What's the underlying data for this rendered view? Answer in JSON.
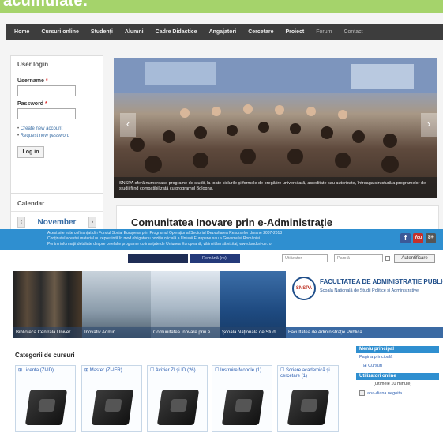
{
  "caption": {
    "text": "acumulate:"
  },
  "site1": {
    "nav": [
      "Home",
      "Cursuri online",
      "Studenți",
      "Alumni",
      "Cadre Didactice",
      "Angajatori",
      "Cercetare",
      "Proiect",
      "Forum",
      "Contact"
    ],
    "login": {
      "title": "User login",
      "username_label": "Username",
      "password_label": "Password",
      "required_mark": "*",
      "links": [
        "Create new account",
        "Request new password"
      ],
      "button": "Log in"
    },
    "calendar": {
      "title": "Calendar",
      "month": "November",
      "prev": "‹",
      "next": "›"
    },
    "slideshow": {
      "caption": "SNSPA oferă numeroase programe de studii, la toate ciclurile și formele de pregătire universitară, acreditate sau autorizate, întreaga structură a programelor de studii fiind compatibilizată cu programul Bologna.",
      "prev": "‹",
      "next": "›"
    },
    "featured_title": "Comunitatea Inovare prin e-Administrație"
  },
  "site2": {
    "notice": [
      "Acest site este cofinanțat din Fondul Social European prin Programul Operațional Sectorial Dezvoltarea Resurselor Umane 2007-2013",
      "Conținutul acestui material nu reprezintă în mod obligatoriu poziția oficială a Uniunii Europene sau a Guvernului României",
      "Pentru informații detaliate despre celelalte programe cofinanțate de Uniunea Europeană, vă invităm să vizitați www.fonduri-ue.ro"
    ],
    "social": [
      "f",
      "You",
      "8+"
    ],
    "language": "Română (ro)",
    "user_placeholder": "Utilizator",
    "pass_placeholder": "Parolă",
    "auth_button": "Autentificare",
    "banner_labels": [
      "Biblioteca Centrală Univer",
      "Inovativ Admin",
      "Comunitatea Inovare prin e",
      "Școala Națională de Studi",
      "Facultatea de Administrație Publică"
    ],
    "brand": {
      "logo": "SNSPA",
      "title": "FACULTATEA DE ADMINISTRAȚIE PUBLIC",
      "subtitle": "Școala Națională de Studii Politice și Administrative"
    },
    "categories_title": "Categorii de cursuri",
    "courses": [
      {
        "title": "⊞ Licenta (ZI-ID)",
        "count": ""
      },
      {
        "title": "⊞ Master (ZI-IFR)",
        "count": ""
      },
      {
        "title": "☐ Avizier ZI și ID",
        "count": "(26)"
      },
      {
        "title": "☐ Instruire Moodle",
        "count": "(1)"
      },
      {
        "title": "☐ Scriere academică și cercetare",
        "count": "(1)"
      }
    ],
    "sidebar": {
      "menu_title": "Meniu principal",
      "menu_items": [
        "Pagina principală",
        "⊞ Cursuri"
      ],
      "online_title": "Utilizatori online",
      "online_note": "(ultimele 10 minute)",
      "online_user": "ana-diana negoita"
    }
  }
}
